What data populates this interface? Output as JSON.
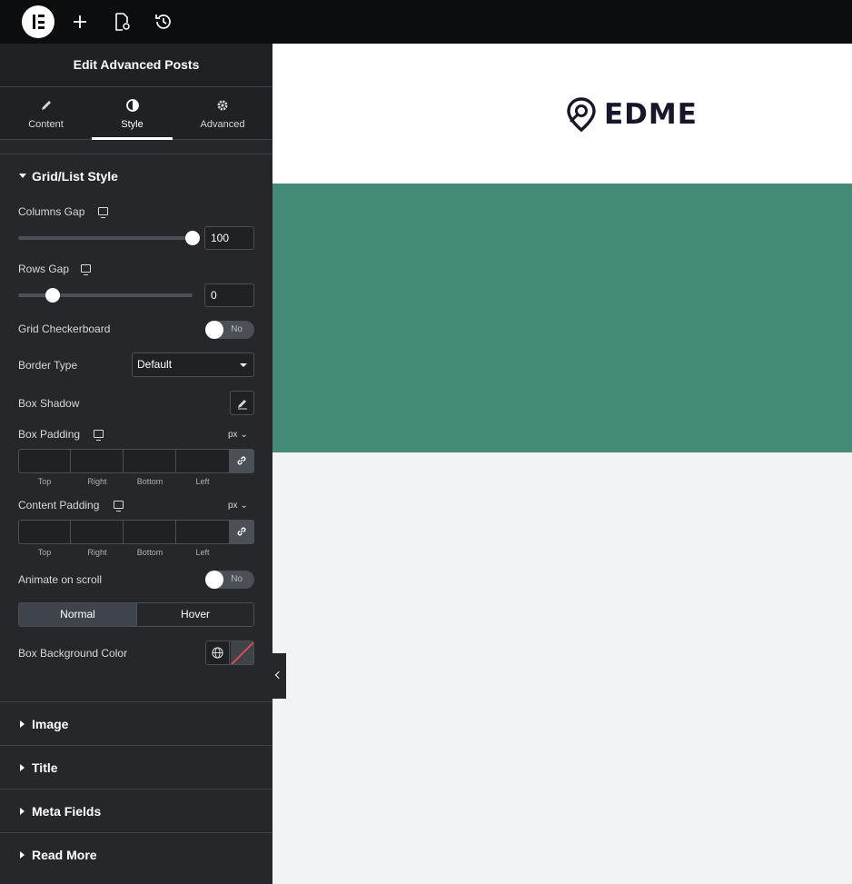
{
  "panel": {
    "title": "Edit Advanced Posts",
    "tabs": [
      {
        "label": "Content",
        "icon": "pencil-icon"
      },
      {
        "label": "Style",
        "icon": "contrast-icon",
        "active": true
      },
      {
        "label": "Advanced",
        "icon": "gear-icon"
      }
    ]
  },
  "grid_section": {
    "title": "Grid/List Style",
    "columns_gap": {
      "label": "Columns Gap",
      "value": "100",
      "fraction": 1.0
    },
    "rows_gap": {
      "label": "Rows Gap",
      "value": "0",
      "fraction": 0.2
    },
    "checkerboard": {
      "label": "Grid Checkerboard",
      "value": "No"
    },
    "border_type": {
      "label": "Border Type",
      "value": "Default"
    },
    "box_shadow": {
      "label": "Box Shadow"
    },
    "box_padding": {
      "label": "Box Padding",
      "unit": "px",
      "fields": [
        "Top",
        "Right",
        "Bottom",
        "Left"
      ]
    },
    "content_padding": {
      "label": "Content Padding",
      "unit": "px",
      "fields": [
        "Top",
        "Right",
        "Bottom",
        "Left"
      ]
    },
    "animate": {
      "label": "Animate on scroll",
      "value": "No"
    },
    "states": {
      "normal": "Normal",
      "hover": "Hover"
    },
    "box_bg": {
      "label": "Box Background Color"
    }
  },
  "sections": [
    "Image",
    "Title",
    "Meta Fields",
    "Read More"
  ],
  "preview": {
    "brand": "EDME",
    "colors": {
      "green": "#438a77",
      "white": "#ffffff",
      "canvas": "#f1f3f5"
    }
  }
}
